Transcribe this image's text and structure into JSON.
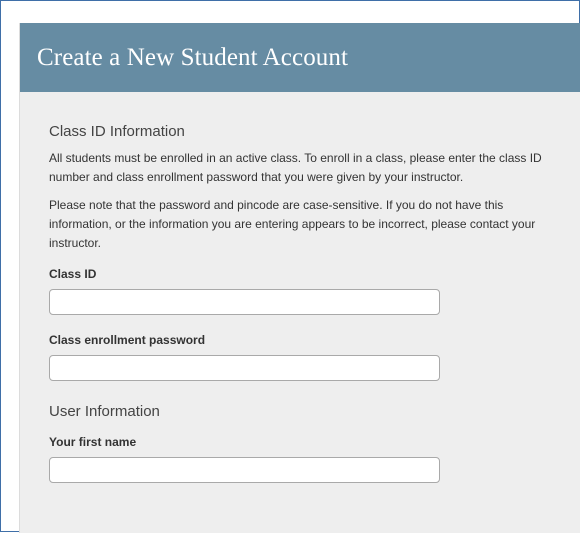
{
  "header": {
    "title": "Create a New Student Account"
  },
  "class_section": {
    "heading": "Class ID Information",
    "paragraph1": "All students must be enrolled in an active class. To enroll in a class, please enter the class ID number and class enrollment password that you were given by your instructor.",
    "paragraph2": "Please note that the password and pincode are case-sensitive. If you do not have this information, or the information you are entering appears to be incorrect, please contact your instructor.",
    "class_id_label": "Class ID",
    "class_id_value": "",
    "enrollment_password_label": "Class enrollment password",
    "enrollment_password_value": ""
  },
  "user_section": {
    "heading": "User Information",
    "first_name_label": "Your first name",
    "first_name_value": ""
  },
  "colors": {
    "header_background": "#668ca3",
    "card_background": "#eeeeee",
    "frame_border": "#3f6fa8"
  }
}
